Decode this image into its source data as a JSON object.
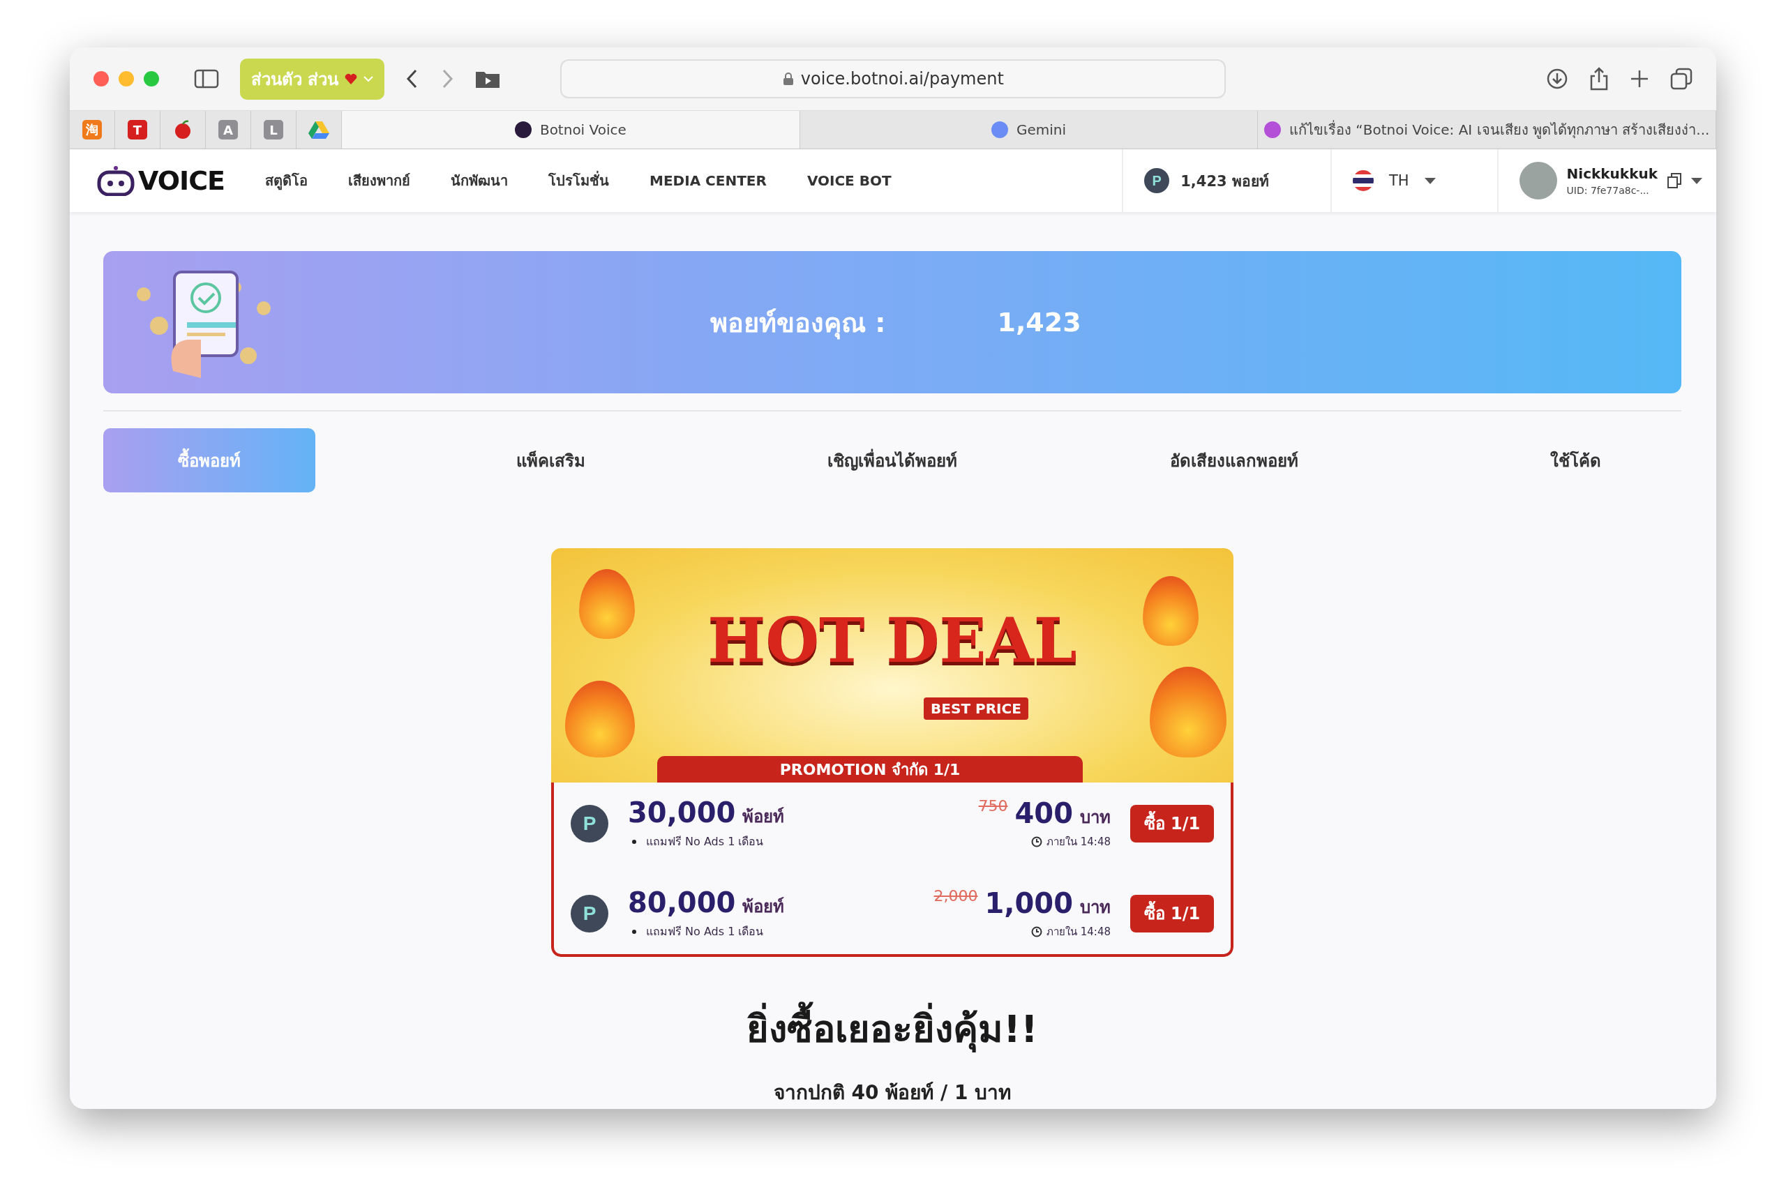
{
  "browser": {
    "profile": "ส่วนตัว ส่วน",
    "address": "voice.botnoi.ai/payment",
    "bookmarks": [
      {
        "kind": "letter",
        "label": "淘"
      },
      {
        "kind": "letter",
        "label": "T"
      },
      {
        "kind": "apple"
      },
      {
        "kind": "letter",
        "label": "A"
      },
      {
        "kind": "letter",
        "label": "L"
      },
      {
        "kind": "drive"
      }
    ],
    "tabs": [
      {
        "title": "Botnoi Voice",
        "selected": true
      },
      {
        "title": "Gemini",
        "selected": false
      },
      {
        "title": "แก้ไขเรื่อง “Botnoi Voice: AI เจนเสียง พูดได้ทุกภาษา สร้างเสียงง่า...",
        "selected": false
      }
    ]
  },
  "nav": {
    "logo": "VOICE",
    "items": [
      "สตูดิโอ",
      "เสียงพากย์",
      "นักพัฒนา",
      "โปรโมชั่น",
      "MEDIA CENTER",
      "VOICE BOT"
    ],
    "points": "1,423 พอยท์",
    "coin_letter": "P",
    "language": "TH",
    "user": {
      "name": "Nickkukkuk",
      "uid": "UID: 7fe77a8c-..."
    }
  },
  "balance": {
    "label": "พอยท์ของคุณ :",
    "value": "1,423"
  },
  "tabs": [
    {
      "label": "ซื้อพอยท์",
      "selected": true
    },
    {
      "label": "แพ็คเสริม",
      "selected": false
    },
    {
      "label": "เชิญเพื่อนได้พอยท์",
      "selected": false
    },
    {
      "label": "อัดเสียงแลกพอยท์",
      "selected": false
    },
    {
      "label": "ใช้โค้ด",
      "selected": false
    }
  ],
  "hot_deal": {
    "title": "HOT DEAL",
    "badge": "BEST PRICE",
    "ribbon": "PROMOTION จำกัด 1/1",
    "offers": [
      {
        "coin_letter": "P",
        "points": "30,000",
        "unit": "พ้อยท์",
        "bonus": "แถมฟรี No Ads 1 เดือน",
        "old_price": "750",
        "price": "400",
        "currency": "บาท",
        "timer": "ภายใน 14:48",
        "button": "ซื้อ 1/1"
      },
      {
        "coin_letter": "P",
        "points": "80,000",
        "unit": "พ้อยท์",
        "bonus": "แถมฟรี No Ads 1 เดือน",
        "old_price": "2,000",
        "price": "1,000",
        "currency": "บาท",
        "timer": "ภายใน 14:48",
        "button": "ซื้อ 1/1"
      }
    ]
  },
  "heading": "ยิ่งซื้อเยอะยิ่งคุ้ม!!",
  "subheading": "จากปกติ 40 พ้อยท์ / 1 บาท"
}
